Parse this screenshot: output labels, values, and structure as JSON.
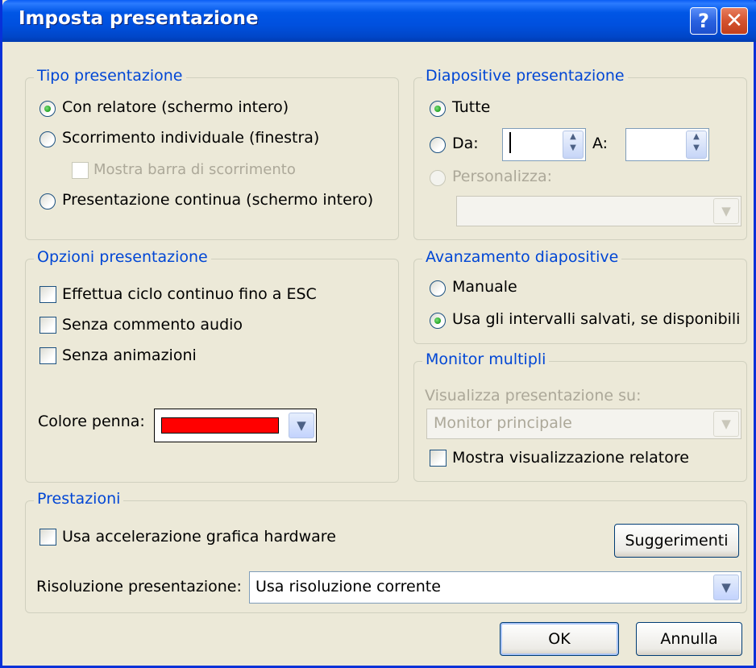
{
  "window": {
    "title": "Imposta presentazione"
  },
  "titlebar": {
    "help_symbol": "?",
    "close_symbol": "✕"
  },
  "tipo_presentazione": {
    "legend": "Tipo presentazione",
    "options": [
      {
        "label": "Con relatore (schermo intero)",
        "checked": true
      },
      {
        "label": "Scorrimento individuale (finestra)",
        "checked": false
      },
      {
        "label": "Presentazione continua (schermo intero)",
        "checked": false
      }
    ],
    "scrollbar_checkbox": {
      "label": "Mostra barra di scorrimento",
      "checked": false,
      "enabled": false
    }
  },
  "diapositive": {
    "legend": "Diapositive presentazione",
    "all_label": "Tutte",
    "from_label": "Da:",
    "from_value": "",
    "to_label": "A:",
    "to_value": "",
    "custom_label": "Personalizza:",
    "custom_value": ""
  },
  "opzioni": {
    "legend": "Opzioni presentazione",
    "loop_label": "Effettua ciclo continuo fino a ESC",
    "no_narration_label": "Senza commento audio",
    "no_animation_label": "Senza animazioni",
    "pen_color_label": "Colore penna:",
    "pen_color": "#FF0000"
  },
  "avanzamento": {
    "legend": "Avanzamento diapositive",
    "manual_label": "Manuale",
    "timings_label": "Usa gli intervalli salvati, se disponibili"
  },
  "monitor": {
    "legend": "Monitor multipli",
    "show_on_label": "Visualizza presentazione su:",
    "monitor_value": "Monitor principale",
    "presenter_view_label": "Mostra visualizzazione relatore"
  },
  "prestazioni": {
    "legend": "Prestazioni",
    "hw_accel_label": "Usa accelerazione grafica hardware",
    "tips_button": "Suggerimenti",
    "resolution_label": "Risoluzione presentazione:",
    "resolution_value": "Usa risoluzione corrente"
  },
  "footer": {
    "ok": "OK",
    "cancel": "Annulla"
  },
  "icons": {
    "dropdown": "chevron-down-icon",
    "spinner": "spin-arrows-icon"
  }
}
